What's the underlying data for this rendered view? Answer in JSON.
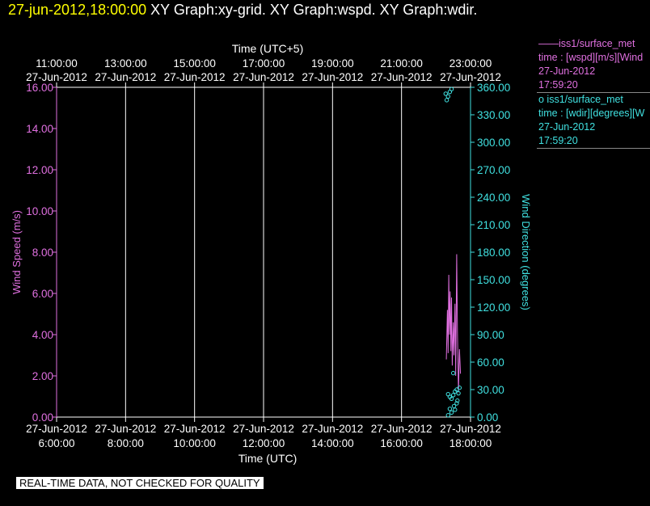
{
  "header": {
    "timestamp": "27-jun-2012,18:00:00",
    "graphs": "XY Graph:xy-grid.  XY Graph:wspd.  XY Graph:wdir."
  },
  "legend": {
    "wspd": {
      "name": "——iss1/surface_met",
      "desc": "time : [wspd][m/s][Wind",
      "date": "27-Jun-2012",
      "time": "17:59:20"
    },
    "wdir": {
      "name": "o iss1/surface_met",
      "desc": "time : [wdir][degrees][W",
      "date": "27-Jun-2012",
      "time": "17:59:20"
    }
  },
  "notice": "REAL-TIME DATA, NOT CHECKED FOR QUALITY",
  "colors": {
    "wspd": "#e070e0",
    "wdir": "#40e0e0",
    "grid": "#ffffff",
    "timestamp": "#ffff00"
  },
  "chart_data": {
    "type": "line",
    "top_axis_title": "Time (UTC+5)",
    "bottom_axis_title": "Time (UTC)",
    "ylabel_left": "Wind Speed (m/s)",
    "ylabel_right": "Wind Direction (degrees)",
    "x_dates": [
      "27-Jun-2012",
      "27-Jun-2012",
      "27-Jun-2012",
      "27-Jun-2012",
      "27-Jun-2012",
      "27-Jun-2012",
      "27-Jun-2012"
    ],
    "x_bottom_ticks": [
      "6:00:00",
      "8:00:00",
      "10:00:00",
      "12:00:00",
      "14:00:00",
      "16:00:00",
      "18:00:00"
    ],
    "x_top_ticks": [
      "11:00:00",
      "13:00:00",
      "15:00:00",
      "17:00:00",
      "19:00:00",
      "21:00:00",
      "23:00:00"
    ],
    "x_range_hours": [
      6,
      18
    ],
    "y_left_ticks": [
      "0.00",
      "2.00",
      "4.00",
      "6.00",
      "8.00",
      "10.00",
      "12.00",
      "14.00",
      "16.00"
    ],
    "y_left_range": [
      0,
      16
    ],
    "y_right_ticks": [
      "0.00",
      "30.00",
      "60.00",
      "90.00",
      "120.00",
      "150.00",
      "180.00",
      "210.00",
      "240.00",
      "270.00",
      "300.00",
      "330.00",
      "360.00"
    ],
    "y_right_range": [
      0,
      360
    ],
    "grid": "vertical",
    "series": [
      {
        "name": "iss1/surface_met wspd",
        "style": "line",
        "points": [
          [
            17.3,
            2.8
          ],
          [
            17.33,
            5.2
          ],
          [
            17.35,
            3.1
          ],
          [
            17.37,
            6.9
          ],
          [
            17.39,
            4.0
          ],
          [
            17.41,
            6.1
          ],
          [
            17.43,
            3.2
          ],
          [
            17.45,
            5.8
          ],
          [
            17.47,
            2.5
          ],
          [
            17.5,
            4.6
          ],
          [
            17.52,
            3.0
          ],
          [
            17.55,
            5.5
          ],
          [
            17.57,
            2.0
          ],
          [
            17.6,
            7.9
          ],
          [
            17.62,
            4.2
          ],
          [
            17.65,
            1.2
          ],
          [
            17.68,
            3.3
          ],
          [
            17.71,
            2.1
          ]
        ]
      },
      {
        "name": "iss1/surface_met wdir",
        "style": "markers",
        "points": [
          [
            17.28,
            353
          ],
          [
            17.31,
            346
          ],
          [
            17.35,
            350
          ],
          [
            17.4,
            355
          ],
          [
            17.45,
            358
          ],
          [
            17.5,
            48
          ],
          [
            17.35,
            25
          ],
          [
            17.4,
            22
          ],
          [
            17.45,
            20
          ],
          [
            17.5,
            24
          ],
          [
            17.55,
            28
          ],
          [
            17.6,
            30
          ],
          [
            17.65,
            26
          ],
          [
            17.68,
            32
          ],
          [
            17.52,
            12
          ],
          [
            17.45,
            5
          ],
          [
            17.4,
            9
          ],
          [
            17.35,
            2
          ],
          [
            17.55,
            8
          ],
          [
            17.6,
            15
          ],
          [
            17.62,
            18
          ]
        ]
      }
    ]
  }
}
